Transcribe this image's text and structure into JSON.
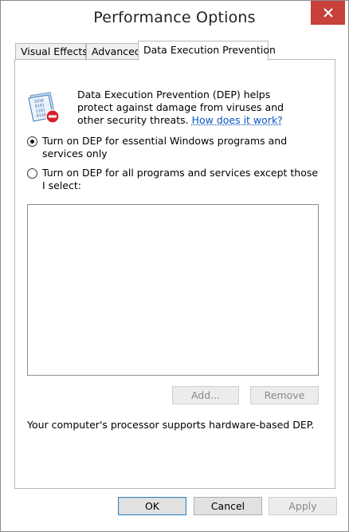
{
  "window": {
    "title": "Performance Options",
    "close_icon": "close-x-icon"
  },
  "tabs": [
    {
      "label": "Visual Effects",
      "active": false
    },
    {
      "label": "Advanced",
      "active": false
    },
    {
      "label": "Data Execution Prevention",
      "active": true
    }
  ],
  "dep": {
    "icon": "dep-shield-icon",
    "intro_text": "Data Execution Prevention (DEP) helps protect against damage from viruses and other security threats.",
    "link_text": "How does it work?",
    "options": [
      {
        "label": "Turn on DEP for essential Windows programs and services only",
        "checked": true
      },
      {
        "label": "Turn on DEP for all programs and services except those I select:",
        "checked": false
      }
    ],
    "exception_list": [],
    "add_label": "Add...",
    "remove_label": "Remove",
    "status_text": "Your computer's processor supports hardware-based DEP."
  },
  "footer": {
    "ok_label": "OK",
    "cancel_label": "Cancel",
    "apply_label": "Apply"
  },
  "colors": {
    "close_button": "#c7403a",
    "link": "#0b55c4"
  }
}
